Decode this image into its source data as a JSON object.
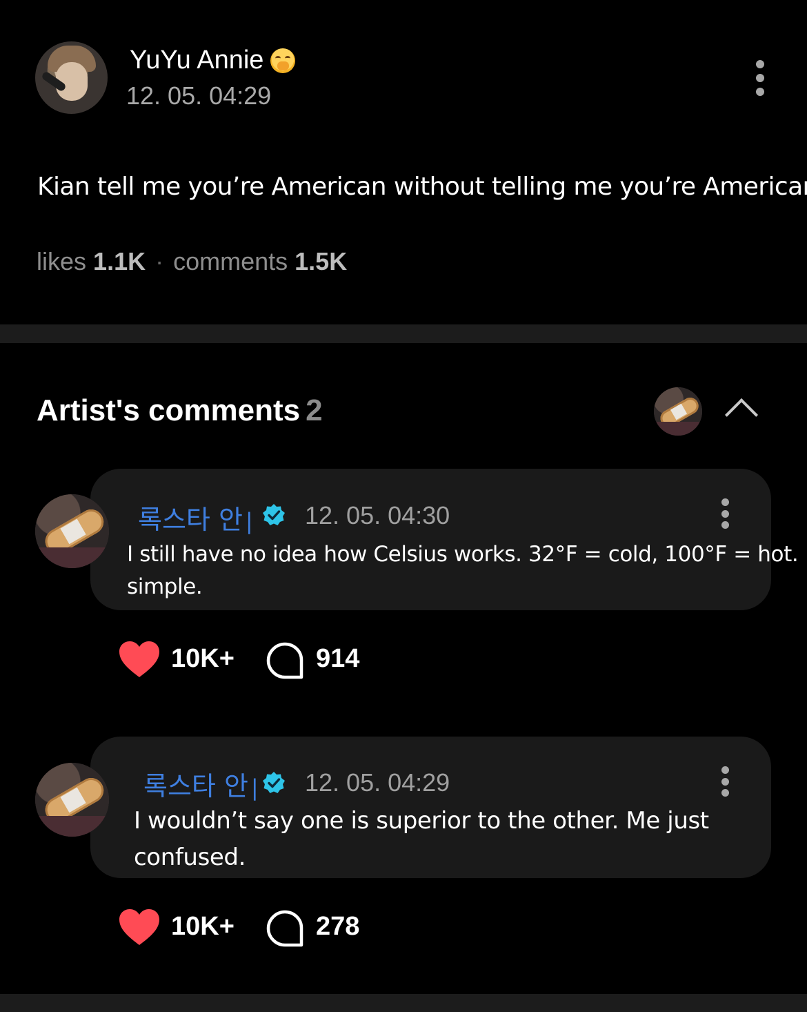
{
  "post": {
    "author_name": "YuYu Annie",
    "author_emoji_icon": "face-with-hand-over-mouth-icon",
    "timestamp": "12. 05. 04:29",
    "body": "Kian tell me you’re American without telling me you’re American?",
    "likes_label": "likes",
    "likes_count": "1.1K",
    "separator": "·",
    "comments_label": "comments",
    "comments_count": "1.5K"
  },
  "artist_comments": {
    "title": "Artist's comments",
    "count": "2",
    "collapse_icon": "chevron-up-icon",
    "items": [
      {
        "author": "록스타 안",
        "name_bar": "|",
        "verified_icon": "verified-badge-icon",
        "timestamp": "12. 05. 04:30",
        "text_line1": "I still have no idea how Celsius works. 32°F = cold, 100°F = hot.",
        "text_line2": "simple.",
        "likes": "10K+",
        "replies": "914"
      },
      {
        "author": "록스타 안",
        "name_bar": "|",
        "verified_icon": "verified-badge-icon",
        "timestamp": "12. 05. 04:29",
        "text_line1": "I wouldn’t say one is superior to the other. Me just",
        "text_line2": "confused.",
        "likes": "10K+",
        "replies": "278"
      }
    ]
  },
  "colors": {
    "background": "#000000",
    "card": "#1a1a1a",
    "artist_name": "#3f7fe0",
    "verified": "#2ec4e8",
    "heart": "#ff4b55",
    "muted_text": "#a0a0a0"
  }
}
